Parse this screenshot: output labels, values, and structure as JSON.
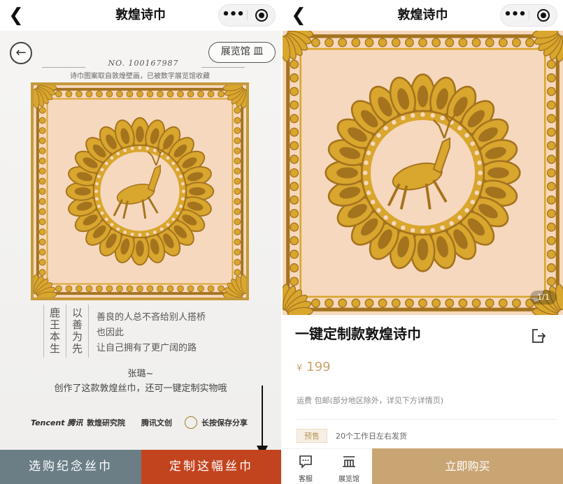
{
  "nav": {
    "title": "敦煌诗巾",
    "more_icon": "•••"
  },
  "left": {
    "gallery_button": "展览馆 皿",
    "serial": "NO. 100167987",
    "tagline": "诗巾图案取自敦煌壁画，已被数字展览馆收藏",
    "poem": {
      "col1": "鹿王本生",
      "col2": "以善为先",
      "lines": [
        "善良的人总不吝给别人搭桥",
        "也因此",
        "让自己拥有了更广阔的路"
      ]
    },
    "author": "张璐~",
    "description": "创作了这款敦煌丝巾，还可一键定制实物哦",
    "logos": {
      "tencent": "Tencent 腾讯",
      "dunhuang": "敦煌研究院",
      "wenchuang": "腾讯文创",
      "save": "长按保存分享"
    },
    "buttons": {
      "buy_souvenir": "选购纪念丝巾",
      "customize": "定制这幅丝巾"
    }
  },
  "right": {
    "image_counter": "1/1",
    "product_title": "一键定制款敦煌诗巾",
    "currency": "¥",
    "price": "199",
    "shipping": "运费  包邮(部分地区除外，详见下方详情页)",
    "presale_badge": "预售",
    "presale_text": "20个工作日左右发货",
    "tabs": {
      "service": "客服",
      "gallery": "展览馆"
    },
    "buy_now": "立即购买"
  },
  "colors": {
    "scarf_bg": "#f6d8be",
    "gold": "#d9a62e",
    "dark_gold": "#a4731e",
    "btn_grey": "#6b7e86",
    "btn_red": "#c2441f",
    "buy_gold": "#c9a574"
  }
}
